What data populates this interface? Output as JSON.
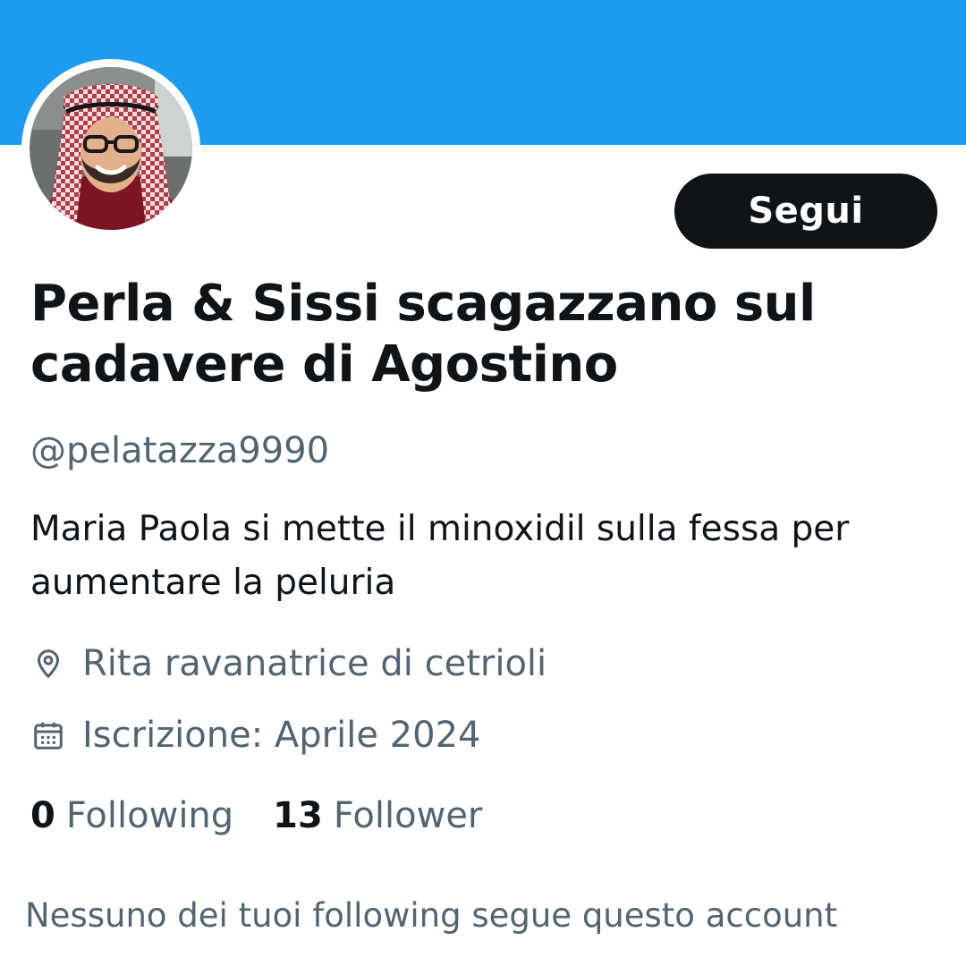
{
  "colors": {
    "banner": "#1d9bf0",
    "follow_button_bg": "#0f1419",
    "follow_button_text": "#ffffff",
    "primary_text": "#0f1419",
    "secondary_text": "#536471"
  },
  "profile": {
    "display_name": "Perla & Sissi scagazzano sul cadavere di Agostino",
    "handle": "@pelatazza9990",
    "bio": "Maria Paola si mette il minoxidil sulla fessa per aumentare la peluria",
    "location": "Rita ravanatrice di cetrioli",
    "joined": "Iscrizione: Aprile 2024",
    "location_icon": "location-pin-icon",
    "joined_icon": "calendar-icon"
  },
  "actions": {
    "follow_label": "Segui"
  },
  "stats": {
    "following_count": "0",
    "following_label": "Following",
    "followers_count": "13",
    "followers_label": "Follower"
  },
  "footer": {
    "known_followers_text": "Nessuno dei tuoi following segue questo account"
  }
}
